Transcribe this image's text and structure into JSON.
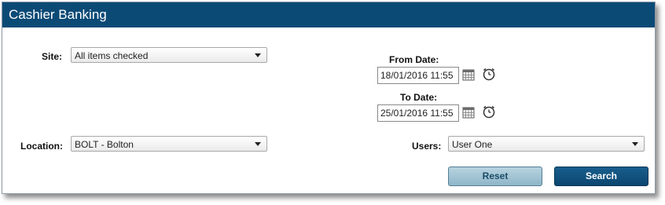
{
  "window": {
    "title": "Cashier Banking"
  },
  "filters": {
    "site": {
      "label": "Site:",
      "value": "All items checked"
    },
    "location": {
      "label": "Location:",
      "value": "BOLT - Bolton"
    },
    "from_date": {
      "label": "From Date:",
      "value": "18/01/2016 11:55"
    },
    "to_date": {
      "label": "To Date:",
      "value": "25/01/2016 11:55"
    },
    "users": {
      "label": "Users:",
      "value": "User One"
    }
  },
  "actions": {
    "reset_label": "Reset",
    "search_label": "Search"
  },
  "icons": {
    "calendar": "calendar-icon",
    "clock": "clock-icon",
    "dropdown": "chevron-down-icon"
  },
  "colors": {
    "title_bar": "#0c4a76",
    "reset_button": "#a3c5d5",
    "search_button": "#0f5280"
  }
}
